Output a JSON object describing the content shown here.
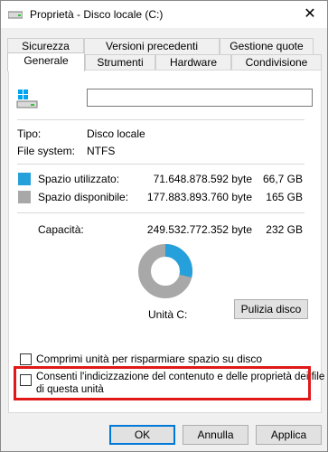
{
  "window": {
    "title": "Proprietà - Disco locale (C:)"
  },
  "tabs": {
    "row1": [
      "Sicurezza",
      "Versioni precedenti",
      "Gestione quote"
    ],
    "row2": [
      "Generale",
      "Strumenti",
      "Hardware",
      "Condivisione"
    ],
    "active": "Generale"
  },
  "general": {
    "name_value": "",
    "type_label": "Tipo:",
    "type_value": "Disco locale",
    "fs_label": "File system:",
    "fs_value": "NTFS",
    "used_label": "Spazio utilizzato:",
    "used_bytes": "71.648.878.592 byte",
    "used_gb": "66,7 GB",
    "free_label": "Spazio disponibile:",
    "free_bytes": "177.883.893.760 byte",
    "free_gb": "165 GB",
    "capacity_label": "Capacità:",
    "capacity_bytes": "249.532.772.352 byte",
    "capacity_gb": "232 GB",
    "drive_label": "Unità C:",
    "cleanup_button": "Pulizia disco",
    "compress_label": "Comprimi unità per risparmiare spazio su disco",
    "index_label_line1": "Consenti l'indicizzazione del contenuto e delle proprietà dei file",
    "index_label_line2": "di questa unità",
    "used_fraction": 0.287
  },
  "colors": {
    "used": "#26a0da",
    "free": "#a8a8a8",
    "highlight": "#e01818"
  },
  "buttons": {
    "ok": "OK",
    "cancel": "Annulla",
    "apply": "Applica"
  }
}
